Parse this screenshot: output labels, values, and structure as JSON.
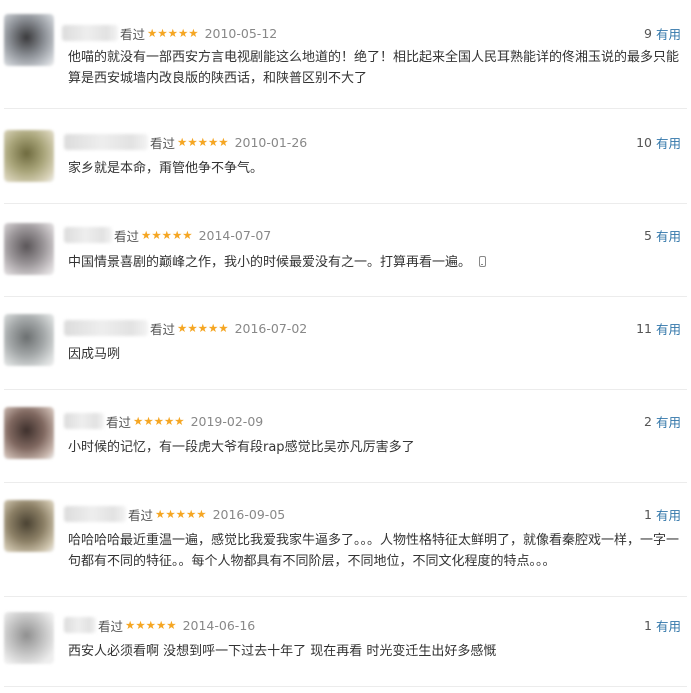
{
  "reviews": [
    {
      "seen": "看过",
      "stars": "★★★★★",
      "date": "2010-05-12",
      "helpful_count": "9",
      "helpful_label": "有用",
      "text": "他喵的就没有一部西安方言电视剧能这么地道的！绝了！相比起来全国人民耳熟能详的佟湘玉说的最多只能算是西安城墙内改良版的陕西话，和陕普区别不大了",
      "avatar_colors": [
        "#3a3a3c",
        "#8a8e94",
        "#c9cdd2"
      ]
    },
    {
      "seen": "看过",
      "stars": "★★★★★",
      "date": "2010-01-26",
      "helpful_count": "10",
      "helpful_label": "有用",
      "text": "家乡就是本命，甭管他争不争气。",
      "avatar_colors": [
        "#6e6a3e",
        "#a9a57a",
        "#d8d2b8"
      ]
    },
    {
      "seen": "看过",
      "stars": "★★★★★",
      "date": "2014-07-07",
      "helpful_count": "5",
      "helpful_label": "有用",
      "text": "中国情景喜剧的巅峰之作，我小的时候最爱没有之一。打算再看一遍。",
      "avatar_colors": [
        "#5a5558",
        "#9b9699",
        "#d6d2d4"
      ]
    },
    {
      "seen": "看过",
      "stars": "★★★★★",
      "date": "2016-07-02",
      "helpful_count": "11",
      "helpful_label": "有用",
      "text": "因成马咧",
      "avatar_colors": [
        "#6b6f70",
        "#a3a7a8",
        "#d9dcdc"
      ]
    },
    {
      "seen": "看过",
      "stars": "★★★★★",
      "date": "2019-02-09",
      "helpful_count": "2",
      "helpful_label": "有用",
      "text": "小时候的记忆，有一段虎大爷有段rap感觉比吴亦凡厉害多了",
      "avatar_colors": [
        "#3e302c",
        "#806860",
        "#c9b7ae"
      ]
    },
    {
      "seen": "看过",
      "stars": "★★★★★",
      "date": "2016-09-05",
      "helpful_count": "1",
      "helpful_label": "有用",
      "text": "哈哈哈哈最近重温一遍，感觉比我爱我家牛逼多了。。。人物性格特征太鲜明了，就像看秦腔戏一样，一字一句都有不同的特征。。每个人物都具有不同阶层，不同地位，不同文化程度的特点。。。",
      "avatar_colors": [
        "#4a4232",
        "#8c8066",
        "#cfc5ae"
      ]
    },
    {
      "seen": "看过",
      "stars": "★★★★★",
      "date": "2014-06-16",
      "helpful_count": "1",
      "helpful_label": "有用",
      "text": "西安人必须看啊 没想到呼一下过去十年了 现在再看 时光变迁生出好多感慨",
      "avatar_colors": [
        "#8f8f8f",
        "#c4c4c4",
        "#ededed"
      ]
    }
  ]
}
